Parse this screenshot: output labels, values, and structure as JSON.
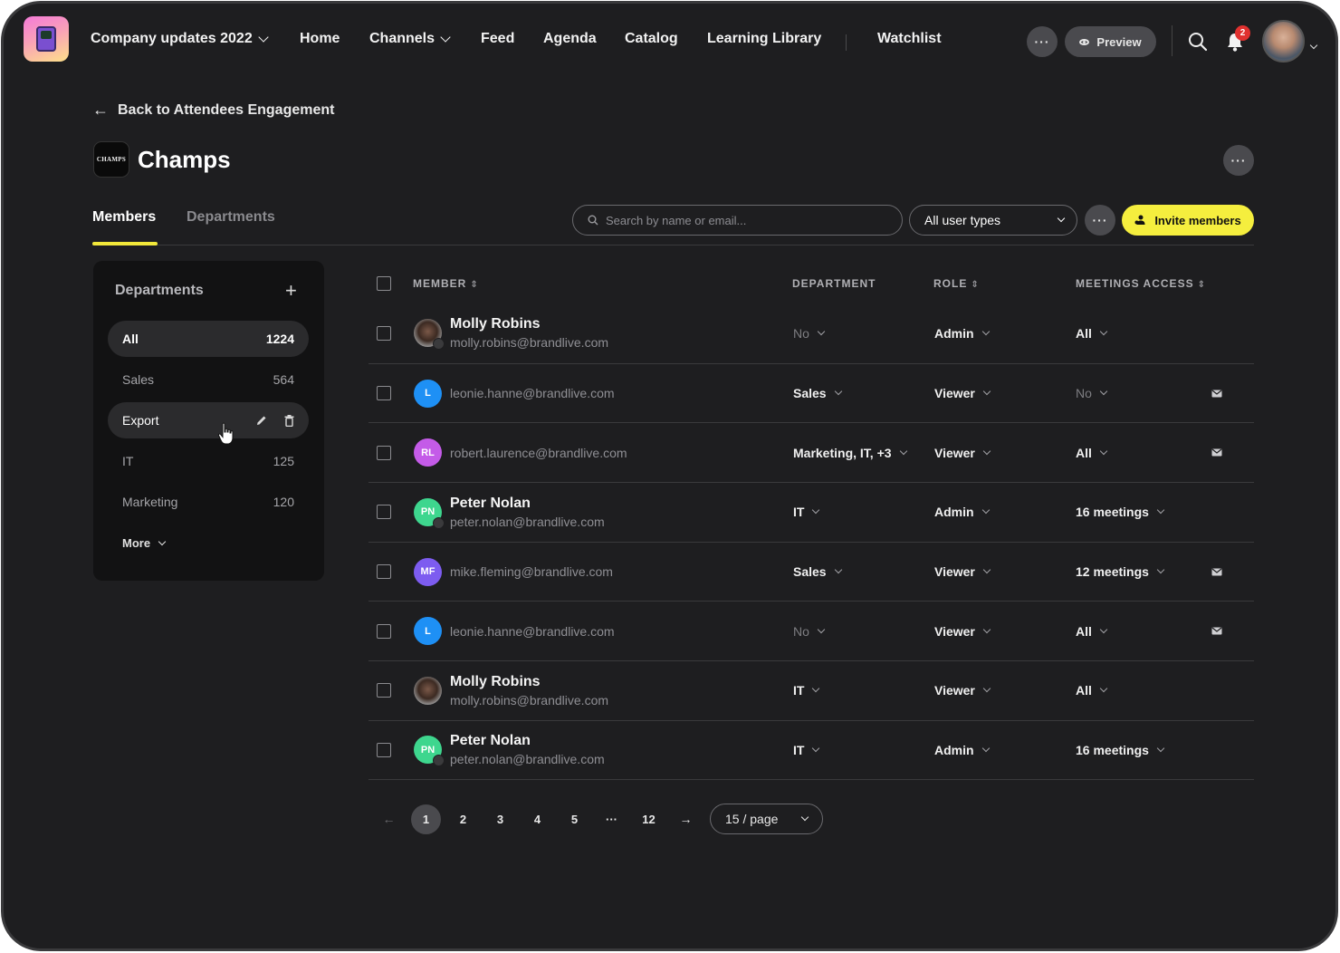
{
  "topnav": {
    "event_title": "Company updates 2022",
    "links": [
      {
        "label": "Home",
        "dropdown": false
      },
      {
        "label": "Channels",
        "dropdown": true
      },
      {
        "label": "Feed",
        "dropdown": false
      },
      {
        "label": "Agenda",
        "dropdown": false
      },
      {
        "label": "Catalog",
        "dropdown": false
      },
      {
        "label": "Learning Library",
        "dropdown": false
      },
      {
        "label": "Watchlist",
        "dropdown": false
      }
    ],
    "more_label": "···",
    "preview_label": "Preview",
    "notification_count": "2",
    "icons": {
      "search": "search-icon",
      "notifications": "bell-icon",
      "preview": "eye-icon"
    }
  },
  "header": {
    "back_label": "Back to Attendees Engagement",
    "group_logo_text": "CHAMPS",
    "title": "Champs",
    "more_label": "···"
  },
  "tabs": [
    {
      "label": "Members",
      "active": true
    },
    {
      "label": "Departments",
      "active": false
    }
  ],
  "toolbar": {
    "search_placeholder": "Search by name or email...",
    "search_value": "",
    "user_type_selected": "All user types",
    "more_label": "···",
    "invite_label": "Invite members",
    "accent_color": "#f5ee3e"
  },
  "departments": {
    "title": "Departments",
    "add_label": "+",
    "items": [
      {
        "label": "All",
        "count": "1224",
        "state": "selected"
      },
      {
        "label": "Sales",
        "count": "564",
        "state": "plain"
      },
      {
        "label": "Export",
        "count": "",
        "state": "hover"
      },
      {
        "label": "IT",
        "count": "125",
        "state": "plain"
      },
      {
        "label": "Marketing",
        "count": "120",
        "state": "plain"
      }
    ],
    "more_label": "More"
  },
  "table": {
    "columns": {
      "member": "MEMBER",
      "department": "DEPARTMENT",
      "role": "ROLE",
      "access": "MEETINGS ACCESS"
    },
    "rows": [
      {
        "name": "Molly Robins",
        "email": "molly.robins@brandlive.com",
        "avatar": {
          "type": "photo",
          "initials": "",
          "color": ""
        },
        "host": true,
        "department": "No",
        "department_dim": true,
        "role": "Admin",
        "access": "All",
        "access_dim": false,
        "mail": false
      },
      {
        "name": "",
        "email": "leonie.hanne@brandlive.com",
        "avatar": {
          "type": "initials",
          "initials": "L",
          "color": "#1e90f5"
        },
        "host": false,
        "department": "Sales",
        "department_dim": false,
        "role": "Viewer",
        "access": "No",
        "access_dim": true,
        "mail": true
      },
      {
        "name": "",
        "email": "robert.laurence@brandlive.com",
        "avatar": {
          "type": "initials",
          "initials": "RL",
          "color": "#c45be8"
        },
        "host": false,
        "department": "Marketing, IT, +3",
        "department_dim": false,
        "role": "Viewer",
        "access": "All",
        "access_dim": false,
        "mail": true
      },
      {
        "name": "Peter Nolan",
        "email": "peter.nolan@brandlive.com",
        "avatar": {
          "type": "initials",
          "initials": "PN",
          "color": "#3ed68e"
        },
        "host": true,
        "department": "IT",
        "department_dim": false,
        "role": "Admin",
        "access": "16 meetings",
        "access_dim": false,
        "mail": false
      },
      {
        "name": "",
        "email": "mike.fleming@brandlive.com",
        "avatar": {
          "type": "initials",
          "initials": "MF",
          "color": "#7d5cf0"
        },
        "host": false,
        "department": "Sales",
        "department_dim": false,
        "role": "Viewer",
        "access": "12 meetings",
        "access_dim": false,
        "mail": true
      },
      {
        "name": "",
        "email": "leonie.hanne@brandlive.com",
        "avatar": {
          "type": "initials",
          "initials": "L",
          "color": "#1e90f5"
        },
        "host": false,
        "department": "No",
        "department_dim": true,
        "role": "Viewer",
        "access": "All",
        "access_dim": false,
        "mail": true
      },
      {
        "name": "Molly Robins",
        "email": "molly.robins@brandlive.com",
        "avatar": {
          "type": "photo",
          "initials": "",
          "color": ""
        },
        "host": false,
        "department": "IT",
        "department_dim": false,
        "role": "Viewer",
        "access": "All",
        "access_dim": false,
        "mail": false
      },
      {
        "name": "Peter Nolan",
        "email": "peter.nolan@brandlive.com",
        "avatar": {
          "type": "initials",
          "initials": "PN",
          "color": "#3ed68e"
        },
        "host": true,
        "department": "IT",
        "department_dim": false,
        "role": "Admin",
        "access": "16 meetings",
        "access_dim": false,
        "mail": false
      }
    ]
  },
  "pagination": {
    "prev_label": "←",
    "pages": [
      "1",
      "2",
      "3",
      "4",
      "5",
      "···",
      "12"
    ],
    "current_page": "1",
    "next_label": "→",
    "per_page": "15 / page"
  }
}
